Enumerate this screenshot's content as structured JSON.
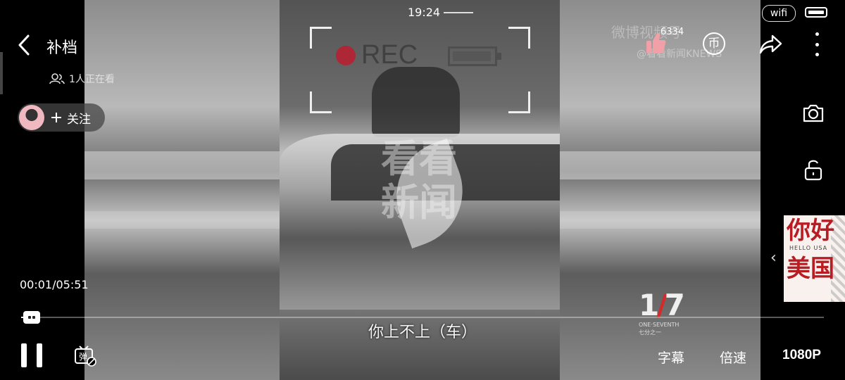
{
  "status_bar": {
    "time": "19:24",
    "wifi_label": "wifi"
  },
  "header": {
    "title": "补档",
    "viewers": "1人正在看",
    "follow_label": "关注"
  },
  "actions": {
    "like_count": "6334",
    "coin_icon_char": "币",
    "icons": [
      "thumbs-up-icon",
      "coin-icon",
      "share-icon",
      "more-icon",
      "camera-icon",
      "unlock-icon"
    ]
  },
  "video": {
    "rec_text": "REC",
    "watermark": "看看\n新闻",
    "subtitle": "你上不上（车）",
    "weibo_mark": "微博视频号",
    "weibo_source": "@看看新闻KNEWS",
    "channel_logo_sub1": "ONE·SEVENTH",
    "channel_logo_sub2": "七分之一"
  },
  "ad": {
    "line1": "你好",
    "subtitle": "HELLO USA",
    "line2": "美国"
  },
  "playback": {
    "time_display": "00:01/05:51",
    "progress_fraction": 0.003
  },
  "controls": {
    "subtitles_label": "字幕",
    "speed_label": "倍速",
    "quality_label": "1080P"
  },
  "colors": {
    "accent_red": "#c0192c",
    "ad_red": "#b81d24"
  }
}
